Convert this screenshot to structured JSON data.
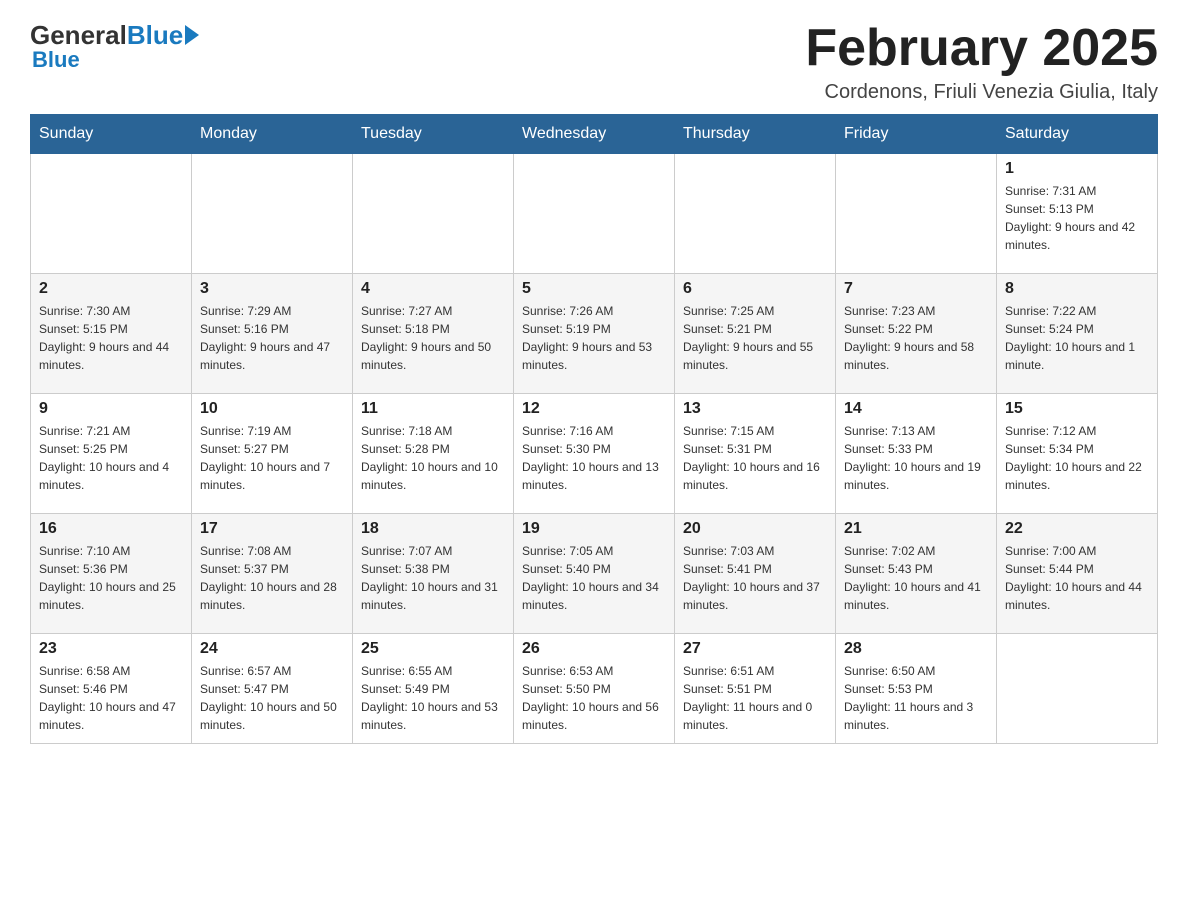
{
  "header": {
    "logo_general": "General",
    "logo_blue": "Blue",
    "month_title": "February 2025",
    "location": "Cordenons, Friuli Venezia Giulia, Italy"
  },
  "days_of_week": [
    "Sunday",
    "Monday",
    "Tuesday",
    "Wednesday",
    "Thursday",
    "Friday",
    "Saturday"
  ],
  "weeks": [
    [
      {
        "day": "",
        "info": ""
      },
      {
        "day": "",
        "info": ""
      },
      {
        "day": "",
        "info": ""
      },
      {
        "day": "",
        "info": ""
      },
      {
        "day": "",
        "info": ""
      },
      {
        "day": "",
        "info": ""
      },
      {
        "day": "1",
        "info": "Sunrise: 7:31 AM\nSunset: 5:13 PM\nDaylight: 9 hours and 42 minutes."
      }
    ],
    [
      {
        "day": "2",
        "info": "Sunrise: 7:30 AM\nSunset: 5:15 PM\nDaylight: 9 hours and 44 minutes."
      },
      {
        "day": "3",
        "info": "Sunrise: 7:29 AM\nSunset: 5:16 PM\nDaylight: 9 hours and 47 minutes."
      },
      {
        "day": "4",
        "info": "Sunrise: 7:27 AM\nSunset: 5:18 PM\nDaylight: 9 hours and 50 minutes."
      },
      {
        "day": "5",
        "info": "Sunrise: 7:26 AM\nSunset: 5:19 PM\nDaylight: 9 hours and 53 minutes."
      },
      {
        "day": "6",
        "info": "Sunrise: 7:25 AM\nSunset: 5:21 PM\nDaylight: 9 hours and 55 minutes."
      },
      {
        "day": "7",
        "info": "Sunrise: 7:23 AM\nSunset: 5:22 PM\nDaylight: 9 hours and 58 minutes."
      },
      {
        "day": "8",
        "info": "Sunrise: 7:22 AM\nSunset: 5:24 PM\nDaylight: 10 hours and 1 minute."
      }
    ],
    [
      {
        "day": "9",
        "info": "Sunrise: 7:21 AM\nSunset: 5:25 PM\nDaylight: 10 hours and 4 minutes."
      },
      {
        "day": "10",
        "info": "Sunrise: 7:19 AM\nSunset: 5:27 PM\nDaylight: 10 hours and 7 minutes."
      },
      {
        "day": "11",
        "info": "Sunrise: 7:18 AM\nSunset: 5:28 PM\nDaylight: 10 hours and 10 minutes."
      },
      {
        "day": "12",
        "info": "Sunrise: 7:16 AM\nSunset: 5:30 PM\nDaylight: 10 hours and 13 minutes."
      },
      {
        "day": "13",
        "info": "Sunrise: 7:15 AM\nSunset: 5:31 PM\nDaylight: 10 hours and 16 minutes."
      },
      {
        "day": "14",
        "info": "Sunrise: 7:13 AM\nSunset: 5:33 PM\nDaylight: 10 hours and 19 minutes."
      },
      {
        "day": "15",
        "info": "Sunrise: 7:12 AM\nSunset: 5:34 PM\nDaylight: 10 hours and 22 minutes."
      }
    ],
    [
      {
        "day": "16",
        "info": "Sunrise: 7:10 AM\nSunset: 5:36 PM\nDaylight: 10 hours and 25 minutes."
      },
      {
        "day": "17",
        "info": "Sunrise: 7:08 AM\nSunset: 5:37 PM\nDaylight: 10 hours and 28 minutes."
      },
      {
        "day": "18",
        "info": "Sunrise: 7:07 AM\nSunset: 5:38 PM\nDaylight: 10 hours and 31 minutes."
      },
      {
        "day": "19",
        "info": "Sunrise: 7:05 AM\nSunset: 5:40 PM\nDaylight: 10 hours and 34 minutes."
      },
      {
        "day": "20",
        "info": "Sunrise: 7:03 AM\nSunset: 5:41 PM\nDaylight: 10 hours and 37 minutes."
      },
      {
        "day": "21",
        "info": "Sunrise: 7:02 AM\nSunset: 5:43 PM\nDaylight: 10 hours and 41 minutes."
      },
      {
        "day": "22",
        "info": "Sunrise: 7:00 AM\nSunset: 5:44 PM\nDaylight: 10 hours and 44 minutes."
      }
    ],
    [
      {
        "day": "23",
        "info": "Sunrise: 6:58 AM\nSunset: 5:46 PM\nDaylight: 10 hours and 47 minutes."
      },
      {
        "day": "24",
        "info": "Sunrise: 6:57 AM\nSunset: 5:47 PM\nDaylight: 10 hours and 50 minutes."
      },
      {
        "day": "25",
        "info": "Sunrise: 6:55 AM\nSunset: 5:49 PM\nDaylight: 10 hours and 53 minutes."
      },
      {
        "day": "26",
        "info": "Sunrise: 6:53 AM\nSunset: 5:50 PM\nDaylight: 10 hours and 56 minutes."
      },
      {
        "day": "27",
        "info": "Sunrise: 6:51 AM\nSunset: 5:51 PM\nDaylight: 11 hours and 0 minutes."
      },
      {
        "day": "28",
        "info": "Sunrise: 6:50 AM\nSunset: 5:53 PM\nDaylight: 11 hours and 3 minutes."
      },
      {
        "day": "",
        "info": ""
      }
    ]
  ]
}
